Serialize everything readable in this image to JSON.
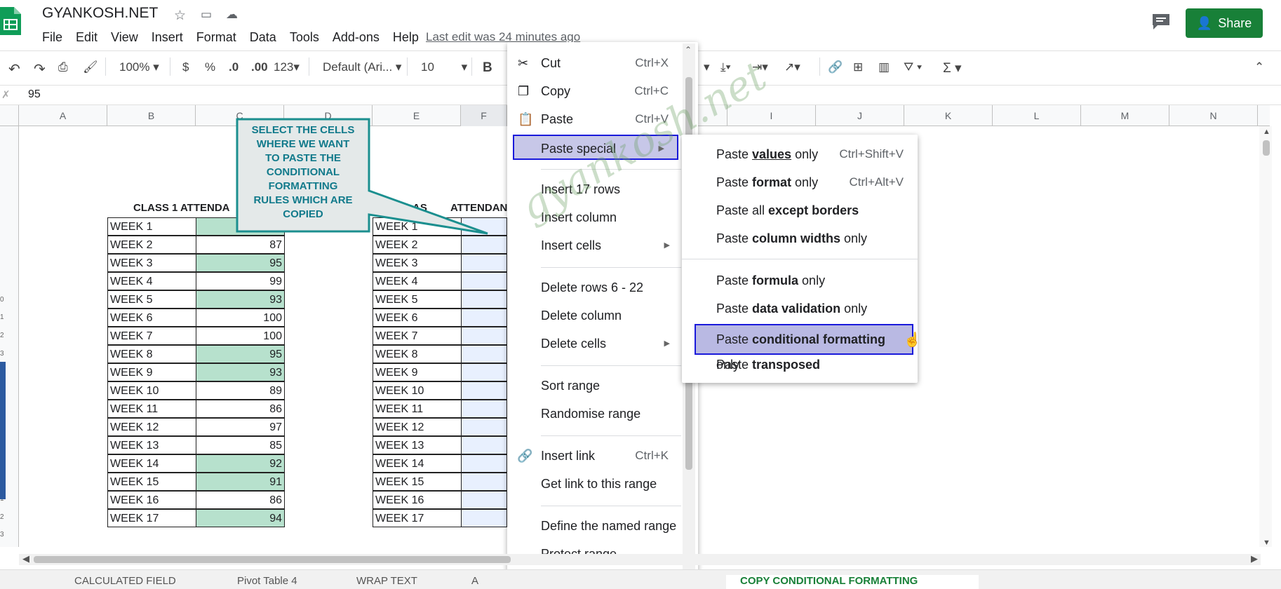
{
  "app": {
    "title": "GYANKOSH.NET",
    "menu": [
      "File",
      "Edit",
      "View",
      "Insert",
      "Format",
      "Data",
      "Tools",
      "Add-ons",
      "Help"
    ],
    "last_edit": "Last edit was 24 minutes ago",
    "share_label": "Share",
    "brand_color": "#188038"
  },
  "toolbar": {
    "zoom": "100%",
    "currency": "$",
    "percent": "%",
    "dec_less": ".0",
    "dec_more": ".00",
    "more_formats": "123",
    "font": "Default (Ari...",
    "font_size": "10",
    "bold": "B"
  },
  "formula_bar": {
    "value": "95"
  },
  "columns": [
    "A",
    "B",
    "C",
    "D",
    "E",
    "F",
    "I",
    "J",
    "K",
    "L",
    "M",
    "N"
  ],
  "row_numbers": [
    "0",
    "1",
    "2",
    "3",
    "1",
    "2",
    "3"
  ],
  "sheet": {
    "table1_header": "CLASS 1 ATTENDA",
    "table2_header": "CLAS",
    "table2_header_tail": "ATTENDAN",
    "weeks": [
      "WEEK 1",
      "WEEK 2",
      "WEEK 3",
      "WEEK 4",
      "WEEK 5",
      "WEEK 6",
      "WEEK 7",
      "WEEK 8",
      "WEEK 9",
      "WEEK 10",
      "WEEK 11",
      "WEEK 12",
      "WEEK 13",
      "WEEK 14",
      "WEEK 15",
      "WEEK 16",
      "WEEK 17"
    ],
    "values": [
      "",
      "87",
      "95",
      "99",
      "93",
      "100",
      "100",
      "95",
      "93",
      "89",
      "86",
      "97",
      "85",
      "92",
      "91",
      "86",
      "94"
    ],
    "highlight_color": "#b7e1cd"
  },
  "callout": {
    "lines": [
      "SELECT THE CELLS",
      "WHERE WE WANT",
      "TO PASTE THE",
      "CONDITIONAL",
      "FORMATTING",
      "RULES WHICH ARE",
      "COPIED"
    ],
    "color": "#117a8b"
  },
  "context_menu": {
    "items": [
      {
        "label": "Cut",
        "shortcut": "Ctrl+X"
      },
      {
        "label": "Copy",
        "shortcut": "Ctrl+C"
      },
      {
        "label": "Paste",
        "shortcut": "Ctrl+V"
      },
      {
        "label": "Paste special"
      },
      {
        "label": "Insert 17 rows"
      },
      {
        "label": "Insert column"
      },
      {
        "label": "Insert cells"
      },
      {
        "label": "Delete rows 6 - 22"
      },
      {
        "label": "Delete column"
      },
      {
        "label": "Delete cells"
      },
      {
        "label": "Sort range"
      },
      {
        "label": "Randomise range"
      },
      {
        "label": "Insert link",
        "shortcut": "Ctrl+K"
      },
      {
        "label": "Get link to this range"
      },
      {
        "label": "Define the named range"
      },
      {
        "label": "Protect range"
      }
    ]
  },
  "submenu": {
    "values_only": {
      "a": "Paste ",
      "b": "values",
      "c": " only",
      "shortcut": "Ctrl+Shift+V"
    },
    "format_only": {
      "a": "Paste ",
      "b": "format",
      "c": " only",
      "shortcut": "Ctrl+Alt+V"
    },
    "except_borders": {
      "a": "Paste all ",
      "b": "except borders"
    },
    "column_widths": {
      "a": "Paste ",
      "b": "column widths",
      "c": " only"
    },
    "formula_only": {
      "a": "Paste ",
      "b": "formula",
      "c": " only"
    },
    "data_validation": {
      "a": "Paste ",
      "b": "data validation",
      "c": " only"
    },
    "conditional_formatting": {
      "a": "Paste ",
      "b": "conditional formatting",
      "c": " only"
    },
    "transposed": {
      "a": "Paste ",
      "b": "transposed"
    }
  },
  "watermark": "gyankosh.net",
  "sheet_tabs": [
    "CALCULATED FIELD",
    "Pivot Table 4",
    "WRAP TEXT",
    "A",
    "COPY CONDITIONAL FORMATTING"
  ]
}
